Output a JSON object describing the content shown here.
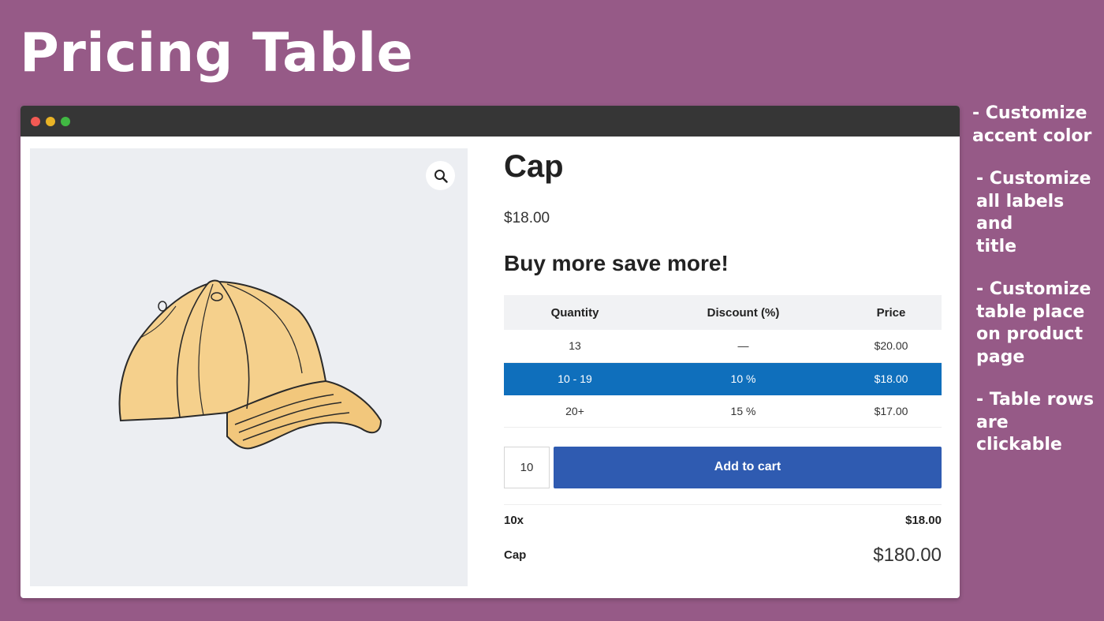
{
  "banner": {
    "title": "Pricing Table"
  },
  "side_notes": [
    "- Customize\naccent color",
    "- Customize\nall labels and\ntitle",
    "- Customize\ntable place\non product\npage",
    "- Table rows\nare clickable"
  ],
  "colors": {
    "background": "#965a87",
    "accent": "#0f6fbc",
    "button": "#2f5bb1"
  },
  "gallery": {
    "zoom_icon": "magnifier-icon",
    "image_subject": "cap"
  },
  "product": {
    "title": "Cap",
    "price": "$18.00",
    "table_heading": "Buy more save more!"
  },
  "pricing_table": {
    "headers": [
      "Quantity",
      "Discount (%)",
      "Price"
    ],
    "rows": [
      {
        "quantity": "13",
        "discount": "—",
        "price": "$20.00"
      },
      {
        "quantity": "10 - 19",
        "discount": "10 %",
        "price": "$18.00",
        "selected": true
      },
      {
        "quantity": "20+",
        "discount": "15 %",
        "price": "$17.00"
      }
    ]
  },
  "cart": {
    "quantity": "10",
    "add_to_cart_label": "Add to cart"
  },
  "totals": {
    "qty_label": "10x",
    "unit_price": "$18.00",
    "product_name": "Cap",
    "total": "$180.00"
  }
}
